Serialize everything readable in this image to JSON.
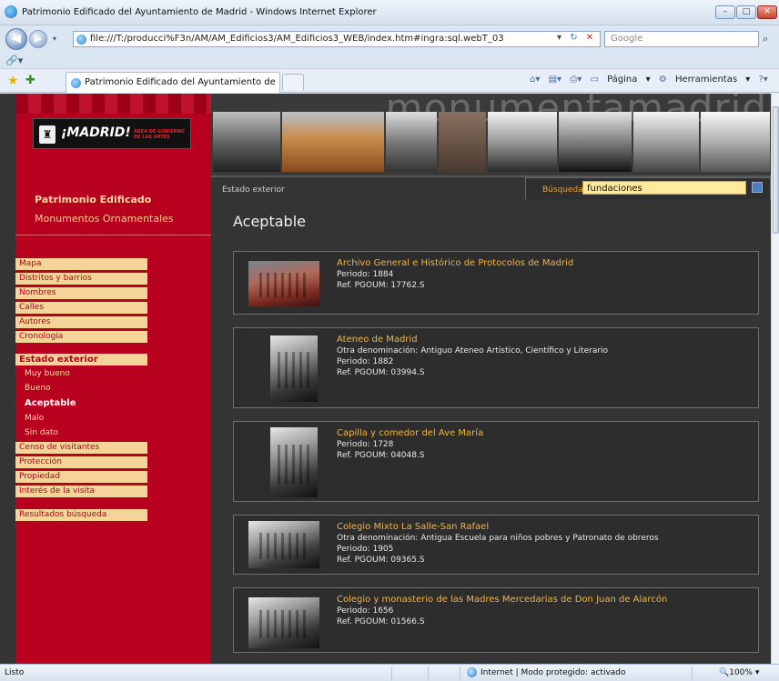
{
  "window": {
    "title": "Patrimonio Edificado del Ayuntamiento de Madrid - Windows Internet Explorer",
    "url": "file:///T:/producci%F3n/AM/AM_Edificios3/AM_Edificios3_WEB/index.htm#ingra:sql.webT_03",
    "search_placeholder": "Google",
    "tab_title": "Patrimonio Edificado del Ayuntamiento de Madrid",
    "cmd_page": "Página",
    "cmd_tools": "Herramientas"
  },
  "site": {
    "logo_text": "¡MADRID!",
    "logo_area": "ÁREA DE GOBIERNO DE LAS ARTES",
    "banner_word": "monumentamadrid",
    "section_title": "Patrimonio Edificado",
    "section_sub": "Monumentos Ornamentales",
    "breadcrumb": "Estado exterior",
    "search_label": "Búsqueda",
    "search_value": "fundaciones",
    "heading": "Aceptable"
  },
  "menu": {
    "group1": [
      "Mapa",
      "Distritos y barrios",
      "Nombres",
      "Calles",
      "Autores",
      "Cronología"
    ],
    "estado_header": "Estado exterior",
    "estado_items": [
      "Muy bueno",
      "Bueno",
      "Aceptable",
      "Malo",
      "Sin dato"
    ],
    "group2": [
      "Censo de visitantes",
      "Protección",
      "Propiedad",
      "Interés de la visita"
    ],
    "results": "Resultados búsqueda"
  },
  "results": [
    {
      "title": "Archivo General e Histórico de Protocolos de Madrid",
      "lines": [
        "Periodo: 1884",
        "Ref. PGOUM: 17762.S"
      ]
    },
    {
      "title": "Ateneo de Madrid",
      "lines": [
        "Otra denominación: Antiguo Ateneo Artístico, Científico y Literario",
        "Periodo: 1882",
        "Ref. PGOUM: 03994.S"
      ]
    },
    {
      "title": "Capilla y comedor del Ave María",
      "lines": [
        "Periodo: 1728",
        "Ref. PGOUM: 04048.S"
      ]
    },
    {
      "title": "Colegio Mixto La Salle-San Rafael",
      "lines": [
        "Otra denominación: Antigua Escuela para niños pobres y Patronato de obreros",
        "Periodo: 1905",
        "Ref. PGOUM: 09365.S"
      ]
    },
    {
      "title": "Colegio y monasterio de las Madres Mercedarias de Don Juan de Alarcón",
      "lines": [
        "Periodo: 1656",
        "Ref. PGOUM: 01566.S"
      ]
    }
  ],
  "status": {
    "left": "Listo",
    "zone": "Internet | Modo protegido: activado",
    "zoom": "100%"
  }
}
